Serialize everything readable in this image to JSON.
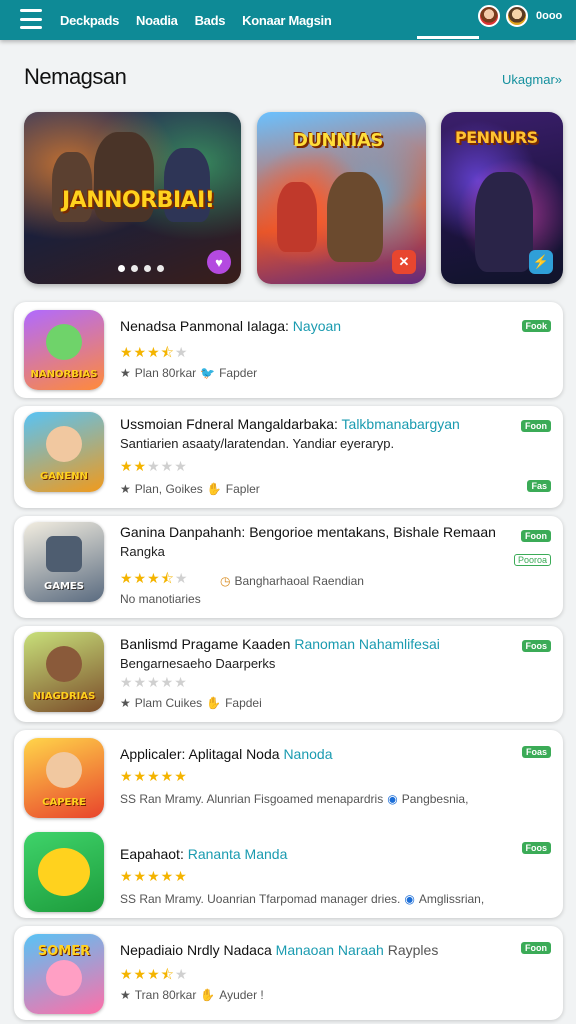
{
  "topbar": {
    "nav": [
      "Deckpads",
      "Noadia",
      "Bads",
      "Konaar Magsin"
    ],
    "count": "0ooo"
  },
  "section": {
    "title": "Nemagsan",
    "more": "Ukagmar»"
  },
  "banners": [
    {
      "title": "JANNORBIAI!",
      "badge_icon": "heart-icon"
    },
    {
      "title": "DUNNIAS",
      "badge_icon": "close-icon"
    },
    {
      "title": "PENNURS",
      "badge_icon": "bolt-icon"
    }
  ],
  "apps": [
    {
      "title": "Nenadsa Panmonal Ialaga:",
      "dev": "Nayoan",
      "subtitle": "",
      "stars": 3.5,
      "meta": "Plan 80rkar",
      "meta2": "Fapder",
      "pill": "Fook",
      "icon_label": "NANORBIAS",
      "colors": [
        "#7ec8ff",
        "#3fb04a"
      ]
    },
    {
      "title": "Ussmoian Fdneral Mangaldarbaka:",
      "dev": "Talkbmanabargyan",
      "subtitle": "Santiarien asaaty/laratendan. Yandiar eyeraryp.",
      "stars": 2,
      "meta": "Plan, Goikes",
      "meta2": "Fapler",
      "pill": "Foon",
      "pill2": "Fas",
      "icon_label": "GANENN",
      "colors": [
        "#58c3f5",
        "#f09a1c"
      ]
    },
    {
      "title": "Ganina Danpahanh: Bengorioe mentakans, Bishale Remaan",
      "dev": "",
      "subtitle": "Rangka",
      "stars": 3.5,
      "meta": "Bangharhaoal Raendian",
      "meta2": "No manotiaries",
      "pill": "Foon",
      "pill_outline": "Pooroa",
      "icon_label": "GAMES",
      "colors": [
        "#e8e3d6",
        "#5a6b80"
      ]
    },
    {
      "title": "Banlismd Pragame Kaaden",
      "dev": "Ranoman Nahamlifesai",
      "subtitle": "Bengarnesaeho Daarperks",
      "stars": 0,
      "meta": "Plam Cuikes",
      "meta2": "Fapdei",
      "pill": "Foos",
      "icon_label": "NIAGDRIAS",
      "colors": [
        "#c8e07a",
        "#7b4d2a"
      ]
    },
    {
      "title": "Applicaler: Aplitagal Noda",
      "dev": "Nanoda",
      "subtitle": "",
      "stars": 5,
      "meta": "SS Ran Mramy. Alunrian Fisgoamed menapardris",
      "meta2": "Pangbesnia,",
      "pill": "Foas",
      "icon_label": "CAPERE",
      "colors": [
        "#ffd54a",
        "#e8442c"
      ]
    },
    {
      "title": "Eapahaot:",
      "dev": "Rananta Manda",
      "subtitle": "",
      "stars": 5,
      "meta": "SS Ran Mramy. Uoanrian Tfarpomad manager dries.",
      "meta2": "Amglissrian,",
      "pill": "Foos",
      "icon_label": "",
      "colors": [
        "#3fd36a",
        "#1d9c3c"
      ]
    },
    {
      "title": "Nepadiaio Nrdly Nadaca",
      "dev": "Manaoan Naraah",
      "dev2": "Rayples",
      "subtitle": "",
      "stars": 3.5,
      "meta": "Tran 80rkar",
      "meta2": "Ayuder !",
      "pill": "Foon",
      "icon_label": "SOMER",
      "colors": [
        "#ff6fa8",
        "#ffd21e"
      ]
    }
  ]
}
